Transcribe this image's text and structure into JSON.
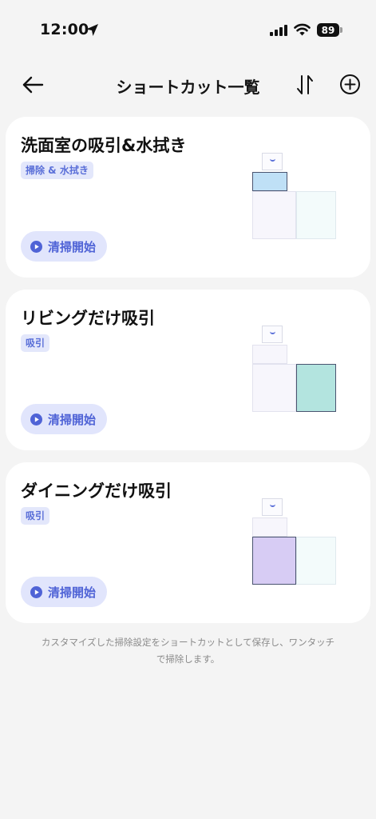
{
  "status_bar": {
    "time": "12:00",
    "battery": "89"
  },
  "header": {
    "title": "ショートカット一覧"
  },
  "shortcuts": [
    {
      "title": "洗面室の吸引&水拭き",
      "mode": "掃除 & 水拭き",
      "start_label": "清掃開始",
      "selected_room": "washroom",
      "highlight_color": "#bfe0f6"
    },
    {
      "title": "リビングだけ吸引",
      "mode": "吸引",
      "start_label": "清掃開始",
      "selected_room": "living",
      "highlight_color": "#b3e4df"
    },
    {
      "title": "ダイニングだけ吸引",
      "mode": "吸引",
      "start_label": "清掃開始",
      "selected_room": "dining",
      "highlight_color": "#d7ccf4"
    }
  ],
  "footer": {
    "line1": "カスタマイズした掃除設定をショートカットとして保存し、ワンタッチ",
    "line2": "で掃除します。"
  },
  "icons": {
    "back": "arrow-left-icon",
    "sort": "sort-arrows-icon",
    "add": "plus-circle-icon",
    "location": "location-arrow-icon",
    "signal": "cellular-signal-icon",
    "wifi": "wifi-icon",
    "play": "play-circle-icon"
  },
  "colors": {
    "accent": "#4f63d6",
    "badge_bg": "#e3e7fb",
    "button_bg": "#e1e5fc"
  }
}
